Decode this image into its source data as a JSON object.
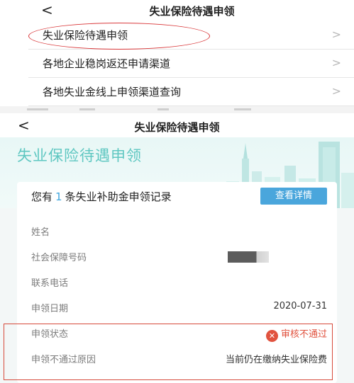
{
  "top": {
    "back_glyph": "<",
    "title": "失业保险待遇申领",
    "menu": [
      {
        "label": "失业保险待遇申领",
        "chevron": ">"
      },
      {
        "label": "各地企业稳岗返还申请渠道",
        "chevron": ">"
      },
      {
        "label": "各地失业金线上申领渠道查询",
        "chevron": ">"
      }
    ],
    "highlight_color": "#d9383a"
  },
  "bottom": {
    "back_glyph": "<",
    "title": "失业保险待遇申领",
    "banner_title": "失业保险待遇申领",
    "card": {
      "head_prefix": "您有",
      "head_count": "1",
      "head_suffix": "条失业补助金申领记录",
      "detail_button": "查看详情",
      "rows": [
        {
          "key": "姓名",
          "value": ""
        },
        {
          "key": "社会保障号码",
          "value": ""
        },
        {
          "key": "联系电话",
          "value": ""
        },
        {
          "key": "申领日期",
          "value": "2020-07-31"
        },
        {
          "key": "申领状态",
          "value": "审核不通过"
        },
        {
          "key": "申领不通过原因",
          "value": "当前仍在缴纳失业保险费"
        }
      ]
    },
    "colors": {
      "accent_teal": "#5fc7c1",
      "button_blue": "#4aa6dc",
      "status_red": "#e1533f"
    }
  }
}
